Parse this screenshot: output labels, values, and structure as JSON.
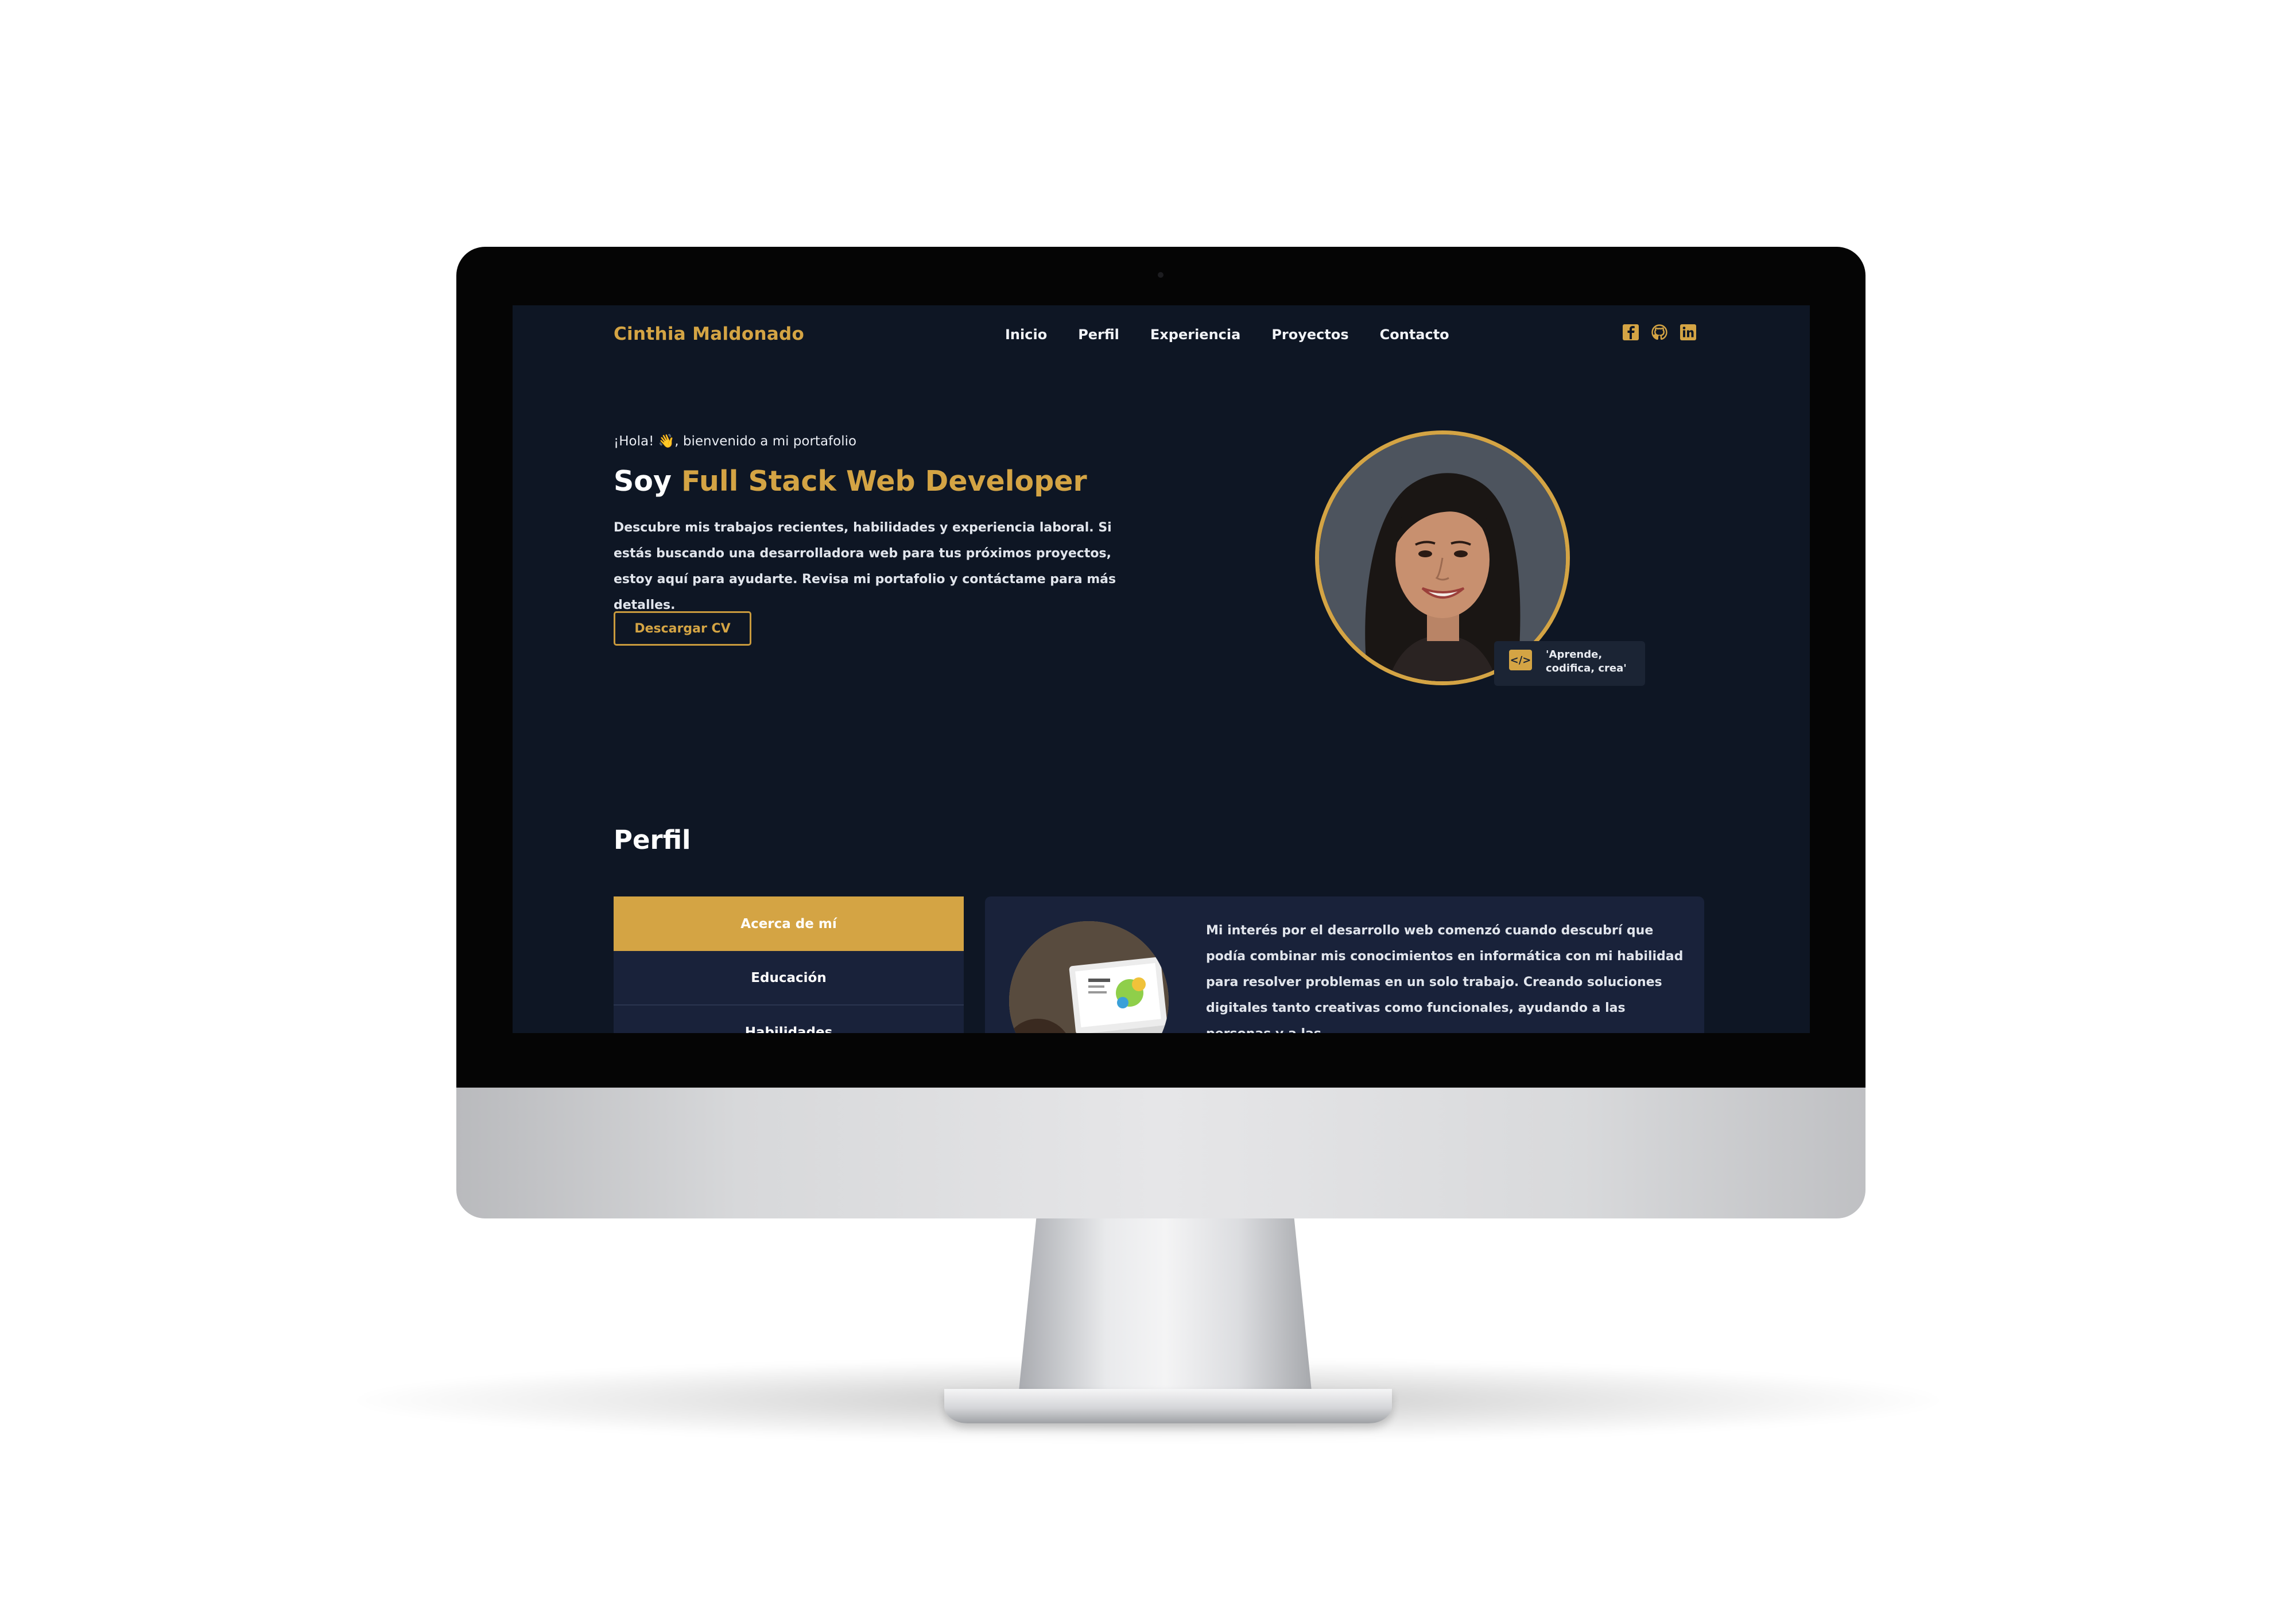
{
  "site": {
    "brand": "Cinthia Maldonado",
    "nav": [
      "Inicio",
      "Perfil",
      "Experiencia",
      "Proyectos",
      "Contacto"
    ],
    "socials": [
      "facebook-icon",
      "github-icon",
      "linkedin-icon"
    ]
  },
  "hero": {
    "greeting": "¡Hola! 👋, bienvenido a mi portafolio",
    "title_prefix": "Soy ",
    "title_accent": "Full Stack Web Developer",
    "description": "Descubre mis trabajos recientes, habilidades y experiencia laboral. Si estás buscando una desarrolladora web para tus próximos proyectos, estoy aquí para ayudarte. Revisa mi portafolio y contáctame para más detalles.",
    "cta_label": "Descargar CV",
    "quote": "'Aprende, codifica, crea'"
  },
  "profile": {
    "section_title": "Perfil",
    "tabs": [
      "Acerca de mí",
      "Educación",
      "Habilidades"
    ],
    "about_text": "Mi interés por el desarrollo web comenzó cuando descubrí que podía combinar mis conocimientos en informática con mi habilidad para resolver problemas en un solo trabajo. Creando soluciones digitales tanto creativas como funcionales, ayudando a las personas y a las"
  },
  "colors": {
    "background": "#0e1624",
    "accent": "#d4a444",
    "card": "#19223a",
    "text": "#e9ecf2"
  }
}
